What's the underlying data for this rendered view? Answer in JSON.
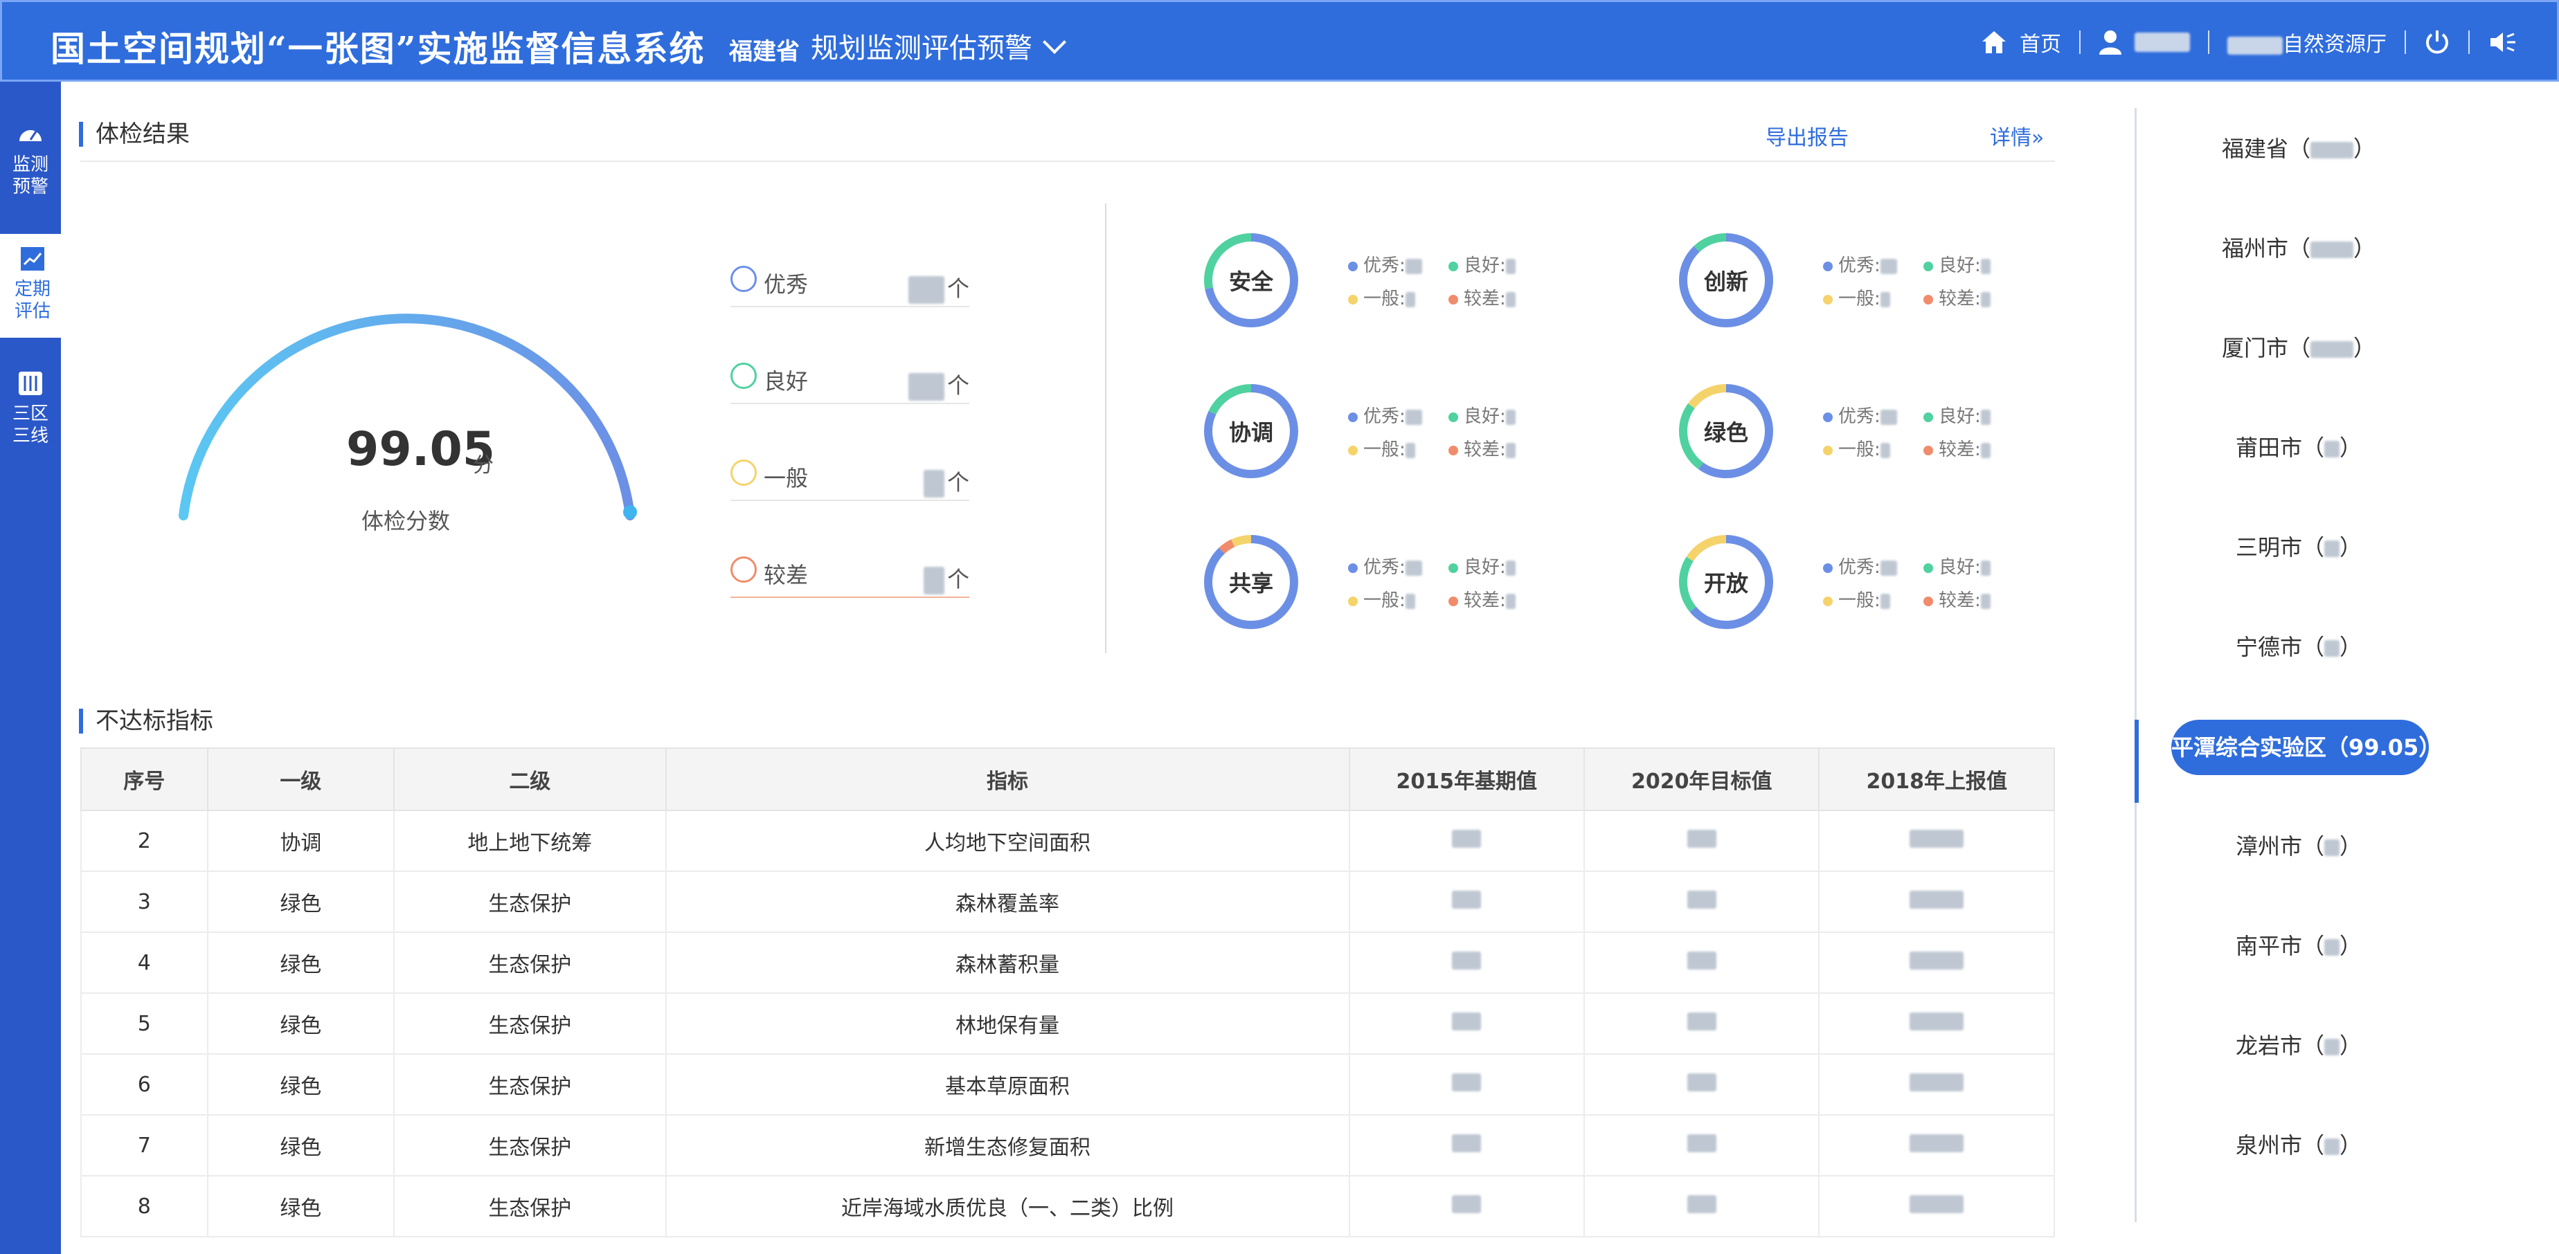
{
  "header": {
    "title": "国土空间规划“一张图”实施监督信息系统",
    "province": "福建省",
    "module": "规划监测评估预警",
    "home": "首页",
    "org_suffix": "自然资源厅"
  },
  "nav": [
    {
      "label_1": "监测",
      "label_2": "预警",
      "icon": "gauge-icon"
    },
    {
      "label_1": "定期",
      "label_2": "评估",
      "icon": "chart-icon"
    },
    {
      "label_1": "三区",
      "label_2": "三线",
      "icon": "sliders-icon"
    }
  ],
  "checkup": {
    "title": "体检结果",
    "export": "导出报告",
    "details": "详情»",
    "score": "99.05",
    "score_unit": "分",
    "score_label": "体检分数",
    "score_max": 100
  },
  "ratings": [
    {
      "label": "优秀",
      "unit": "个",
      "color": "#6c8fe6"
    },
    {
      "label": "良好",
      "unit": "个",
      "color": "#4fd1a0"
    },
    {
      "label": "一般",
      "unit": "个",
      "color": "#f5d36b"
    },
    {
      "label": "较差",
      "unit": "个",
      "color": "#f08c6c"
    }
  ],
  "categories": [
    {
      "name": "安全"
    },
    {
      "name": "创新"
    },
    {
      "name": "协调"
    },
    {
      "name": "绿色"
    },
    {
      "name": "共享"
    },
    {
      "name": "开放"
    }
  ],
  "stat_labels": {
    "excellent": "优秀:",
    "good": "良好:",
    "average": "一般:",
    "poor": "较差:"
  },
  "failed": {
    "title": "不达标指标",
    "columns": [
      "序号",
      "一级",
      "二级",
      "指标",
      "2015年基期值",
      "2020年目标值",
      "2018年上报值"
    ],
    "rows": [
      [
        "2",
        "协调",
        "地上地下统筹",
        "人均地下空间面积"
      ],
      [
        "3",
        "绿色",
        "生态保护",
        "森林覆盖率"
      ],
      [
        "4",
        "绿色",
        "生态保护",
        "森林蓄积量"
      ],
      [
        "5",
        "绿色",
        "生态保护",
        "林地保有量"
      ],
      [
        "6",
        "绿色",
        "生态保护",
        "基本草原面积"
      ],
      [
        "7",
        "绿色",
        "生态保护",
        "新增生态修复面积"
      ],
      [
        "8",
        "绿色",
        "生态保护",
        "近岸海域水质优良（一、二类）比例"
      ]
    ]
  },
  "cities": [
    {
      "name": "福建省（",
      "close": "）"
    },
    {
      "name": "福州市（",
      "close": "）"
    },
    {
      "name": "厦门市（",
      "close": "）"
    },
    {
      "name": "莆田市（",
      "close": "）"
    },
    {
      "name": "三明市（",
      "close": "）"
    },
    {
      "name": "宁德市（",
      "close": "）"
    },
    {
      "name": "平潭综合实验区（99.05）",
      "close": ""
    },
    {
      "name": "漳州市（",
      "close": "）"
    },
    {
      "name": "南平市（",
      "close": "）"
    },
    {
      "name": "龙岩市（",
      "close": "）"
    },
    {
      "name": "泉州市（",
      "close": "）"
    }
  ]
}
